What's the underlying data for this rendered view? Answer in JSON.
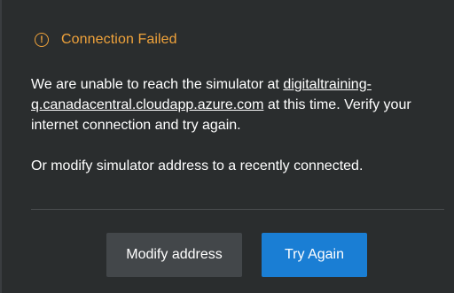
{
  "dialog": {
    "title": "Connection Failed",
    "icon": "warning-circle-icon",
    "message": {
      "before_link": "We are unable to reach the simulator at ",
      "link": "digitaltraining-q.canadacentral.cloudapp.azure.com",
      "after_link": " at this time. Verify your internet connection and try again.",
      "second": "Or modify simulator address to a recently connected."
    },
    "buttons": {
      "modify": "Modify address",
      "retry": "Try Again"
    }
  },
  "colors": {
    "background": "#2a2d2e",
    "warning": "#f0a33b",
    "primary_button": "#1a7ed4",
    "secondary_button": "#43474a"
  }
}
